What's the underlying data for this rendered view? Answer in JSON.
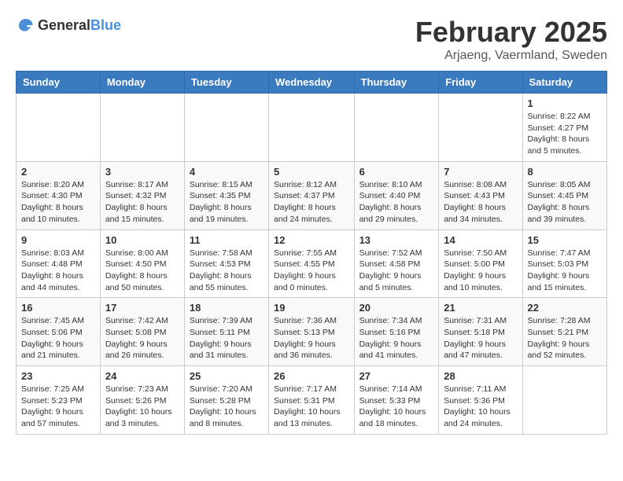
{
  "header": {
    "logo_general": "General",
    "logo_blue": "Blue",
    "title": "February 2025",
    "subtitle": "Arjaeng, Vaermland, Sweden"
  },
  "days_of_week": [
    "Sunday",
    "Monday",
    "Tuesday",
    "Wednesday",
    "Thursday",
    "Friday",
    "Saturday"
  ],
  "weeks": [
    [
      {
        "day": "",
        "info": ""
      },
      {
        "day": "",
        "info": ""
      },
      {
        "day": "",
        "info": ""
      },
      {
        "day": "",
        "info": ""
      },
      {
        "day": "",
        "info": ""
      },
      {
        "day": "",
        "info": ""
      },
      {
        "day": "1",
        "info": "Sunrise: 8:22 AM\nSunset: 4:27 PM\nDaylight: 8 hours and 5 minutes."
      }
    ],
    [
      {
        "day": "2",
        "info": "Sunrise: 8:20 AM\nSunset: 4:30 PM\nDaylight: 8 hours and 10 minutes."
      },
      {
        "day": "3",
        "info": "Sunrise: 8:17 AM\nSunset: 4:32 PM\nDaylight: 8 hours and 15 minutes."
      },
      {
        "day": "4",
        "info": "Sunrise: 8:15 AM\nSunset: 4:35 PM\nDaylight: 8 hours and 19 minutes."
      },
      {
        "day": "5",
        "info": "Sunrise: 8:12 AM\nSunset: 4:37 PM\nDaylight: 8 hours and 24 minutes."
      },
      {
        "day": "6",
        "info": "Sunrise: 8:10 AM\nSunset: 4:40 PM\nDaylight: 8 hours and 29 minutes."
      },
      {
        "day": "7",
        "info": "Sunrise: 8:08 AM\nSunset: 4:43 PM\nDaylight: 8 hours and 34 minutes."
      },
      {
        "day": "8",
        "info": "Sunrise: 8:05 AM\nSunset: 4:45 PM\nDaylight: 8 hours and 39 minutes."
      }
    ],
    [
      {
        "day": "9",
        "info": "Sunrise: 8:03 AM\nSunset: 4:48 PM\nDaylight: 8 hours and 44 minutes."
      },
      {
        "day": "10",
        "info": "Sunrise: 8:00 AM\nSunset: 4:50 PM\nDaylight: 8 hours and 50 minutes."
      },
      {
        "day": "11",
        "info": "Sunrise: 7:58 AM\nSunset: 4:53 PM\nDaylight: 8 hours and 55 minutes."
      },
      {
        "day": "12",
        "info": "Sunrise: 7:55 AM\nSunset: 4:55 PM\nDaylight: 9 hours and 0 minutes."
      },
      {
        "day": "13",
        "info": "Sunrise: 7:52 AM\nSunset: 4:58 PM\nDaylight: 9 hours and 5 minutes."
      },
      {
        "day": "14",
        "info": "Sunrise: 7:50 AM\nSunset: 5:00 PM\nDaylight: 9 hours and 10 minutes."
      },
      {
        "day": "15",
        "info": "Sunrise: 7:47 AM\nSunset: 5:03 PM\nDaylight: 9 hours and 15 minutes."
      }
    ],
    [
      {
        "day": "16",
        "info": "Sunrise: 7:45 AM\nSunset: 5:06 PM\nDaylight: 9 hours and 21 minutes."
      },
      {
        "day": "17",
        "info": "Sunrise: 7:42 AM\nSunset: 5:08 PM\nDaylight: 9 hours and 26 minutes."
      },
      {
        "day": "18",
        "info": "Sunrise: 7:39 AM\nSunset: 5:11 PM\nDaylight: 9 hours and 31 minutes."
      },
      {
        "day": "19",
        "info": "Sunrise: 7:36 AM\nSunset: 5:13 PM\nDaylight: 9 hours and 36 minutes."
      },
      {
        "day": "20",
        "info": "Sunrise: 7:34 AM\nSunset: 5:16 PM\nDaylight: 9 hours and 41 minutes."
      },
      {
        "day": "21",
        "info": "Sunrise: 7:31 AM\nSunset: 5:18 PM\nDaylight: 9 hours and 47 minutes."
      },
      {
        "day": "22",
        "info": "Sunrise: 7:28 AM\nSunset: 5:21 PM\nDaylight: 9 hours and 52 minutes."
      }
    ],
    [
      {
        "day": "23",
        "info": "Sunrise: 7:25 AM\nSunset: 5:23 PM\nDaylight: 9 hours and 57 minutes."
      },
      {
        "day": "24",
        "info": "Sunrise: 7:23 AM\nSunset: 5:26 PM\nDaylight: 10 hours and 3 minutes."
      },
      {
        "day": "25",
        "info": "Sunrise: 7:20 AM\nSunset: 5:28 PM\nDaylight: 10 hours and 8 minutes."
      },
      {
        "day": "26",
        "info": "Sunrise: 7:17 AM\nSunset: 5:31 PM\nDaylight: 10 hours and 13 minutes."
      },
      {
        "day": "27",
        "info": "Sunrise: 7:14 AM\nSunset: 5:33 PM\nDaylight: 10 hours and 18 minutes."
      },
      {
        "day": "28",
        "info": "Sunrise: 7:11 AM\nSunset: 5:36 PM\nDaylight: 10 hours and 24 minutes."
      },
      {
        "day": "",
        "info": ""
      }
    ]
  ]
}
